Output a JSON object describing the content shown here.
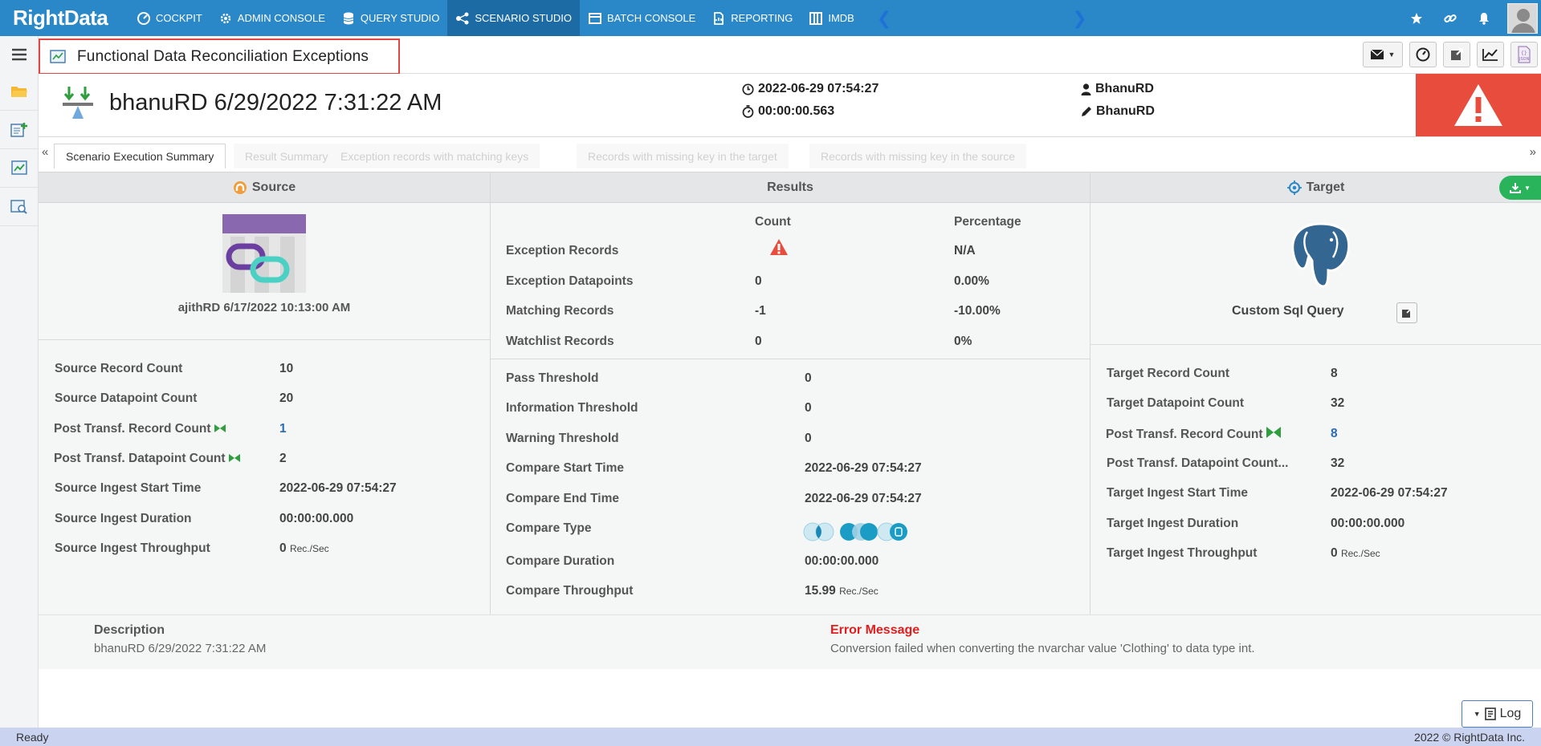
{
  "brand": {
    "logo_text": "RightData"
  },
  "nav": {
    "items": [
      {
        "label": "COCKPIT",
        "icon": "cockpit-icon"
      },
      {
        "label": "ADMIN CONSOLE",
        "icon": "gear-icon"
      },
      {
        "label": "QUERY STUDIO",
        "icon": "database-icon"
      },
      {
        "label": "SCENARIO STUDIO",
        "icon": "hierarchy-icon",
        "active": true
      },
      {
        "label": "BATCH CONSOLE",
        "icon": "batch-icon"
      },
      {
        "label": "REPORTING",
        "icon": "report-icon"
      },
      {
        "label": "IMDB",
        "icon": "columns-icon"
      }
    ],
    "right_icons": [
      "star-icon",
      "link-icon",
      "bell-icon",
      "avatar"
    ]
  },
  "header": {
    "title": "Functional Data Reconciliation Exceptions",
    "buttons": [
      "email-icon",
      "speed-icon",
      "open-external-icon",
      "chart-icon",
      "json-icon"
    ]
  },
  "execution": {
    "name": "bhanuRD 6/29/2022 7:31:22 AM",
    "start_time": "2022-06-29 07:54:27",
    "duration": "00:00:00.563",
    "owner": "BhanuRD",
    "modified_by": "BhanuRD",
    "status": "error"
  },
  "tabs": [
    {
      "label": "Scenario Execution Summary",
      "active": true
    },
    {
      "label": "Result Summary"
    },
    {
      "label": "Exception records with matching keys"
    },
    {
      "label": "Records with missing key in the target"
    },
    {
      "label": "Records with missing key in the source"
    }
  ],
  "source": {
    "heading": "Source",
    "name": "ajithRD 6/17/2022 10:13:00 AM",
    "stats": [
      {
        "label": "Source Record Count",
        "value": "10"
      },
      {
        "label": "Source Datapoint Count",
        "value": "20"
      },
      {
        "label": "Post Transf. Record Count",
        "value": "1",
        "link": true
      },
      {
        "label": "Post Transf. Datapoint Count",
        "value": "2"
      },
      {
        "label": "Source Ingest Start Time",
        "value": "2022-06-29 07:54:27"
      },
      {
        "label": "Source Ingest Duration",
        "value": "00:00:00.000"
      },
      {
        "label": "Source Ingest Throughput",
        "value": "0",
        "unit": "Rec./Sec"
      }
    ]
  },
  "results": {
    "heading": "Results",
    "count_header": "Count",
    "percent_header": "Percentage",
    "rows": [
      {
        "label": "Exception Records",
        "count": "",
        "percent": "N/A"
      },
      {
        "label": "Exception Datapoints",
        "count": "0",
        "percent": "0.00%"
      },
      {
        "label": "Matching Records",
        "count": "-1",
        "percent": "-10.00%"
      },
      {
        "label": "Watchlist Records",
        "count": "0",
        "percent": "0%"
      }
    ],
    "details": [
      {
        "label": "Pass Threshold",
        "value": "0"
      },
      {
        "label": "Information Threshold",
        "value": "0"
      },
      {
        "label": "Warning Threshold",
        "value": "0"
      },
      {
        "label": "Compare Start Time",
        "value": "2022-06-29 07:54:27"
      },
      {
        "label": "Compare End Time",
        "value": "2022-06-29 07:54:27"
      },
      {
        "label": "Compare Type",
        "value": ""
      },
      {
        "label": "Compare Duration",
        "value": "00:00:00.000"
      },
      {
        "label": "Compare Throughput",
        "value": "15.99",
        "unit": "Rec./Sec"
      }
    ]
  },
  "target": {
    "heading": "Target",
    "name": "Custom Sql Query",
    "stats": [
      {
        "label": "Target Record Count",
        "value": "8"
      },
      {
        "label": "Target Datapoint Count",
        "value": "32"
      },
      {
        "label": "Post Transf. Record Count",
        "value": "8",
        "link": true
      },
      {
        "label": "Post Transf. Datapoint Count...",
        "value": "32"
      },
      {
        "label": "Target Ingest Start Time",
        "value": "2022-06-29 07:54:27"
      },
      {
        "label": "Target Ingest Duration",
        "value": "00:00:00.000"
      },
      {
        "label": "Target Ingest Throughput",
        "value": "0",
        "unit": "Rec./Sec"
      }
    ]
  },
  "description": {
    "label": "Description",
    "text": "bhanuRD 6/29/2022 7:31:22 AM",
    "error_label": "Error Message",
    "error_text": "Conversion failed when converting the nvarchar value 'Clothing' to data type int."
  },
  "log_button": "Log",
  "status_bar": {
    "left": "Ready",
    "right": "2022 © RightData Inc."
  },
  "colors": {
    "nav": "#2b88c8",
    "nav_active": "#1d6ba5",
    "error": "#e74c3c",
    "download": "#29b35b",
    "status_bar": "#cad3f0"
  }
}
